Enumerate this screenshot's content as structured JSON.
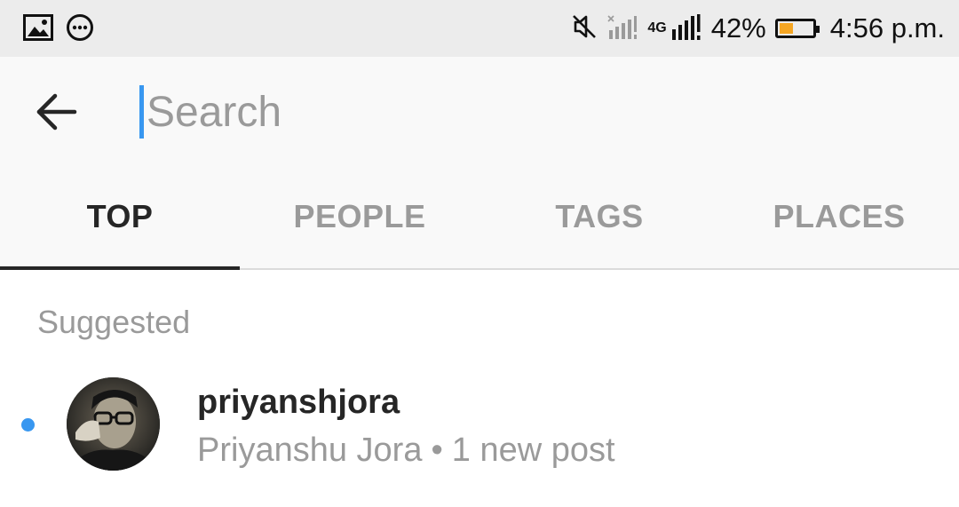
{
  "status_bar": {
    "battery_percent": "42%",
    "time": "4:56 p.m.",
    "network_label": "4G",
    "icons": [
      "image-icon",
      "more-circle-icon",
      "mute-icon",
      "signal-no-sim-icon",
      "signal-4g-icon",
      "battery-icon"
    ],
    "battery_level": 0.42,
    "battery_color": "#f5a623"
  },
  "search": {
    "placeholder": "Search",
    "value": ""
  },
  "tabs": [
    {
      "label": "TOP",
      "active": true
    },
    {
      "label": "PEOPLE",
      "active": false
    },
    {
      "label": "TAGS",
      "active": false
    },
    {
      "label": "PLACES",
      "active": false
    }
  ],
  "suggested": {
    "title": "Suggested",
    "items": [
      {
        "username": "priyanshjora",
        "full_name": "Priyanshu Jora",
        "separator": "•",
        "meta": "1 new post",
        "unread_dot_color": "#3897f0"
      }
    ]
  },
  "colors": {
    "accent": "#3897f0",
    "text_primary": "#262626",
    "text_secondary": "#9a9a9a",
    "header_bg": "#f9f9f9",
    "status_bg": "#ececec"
  }
}
